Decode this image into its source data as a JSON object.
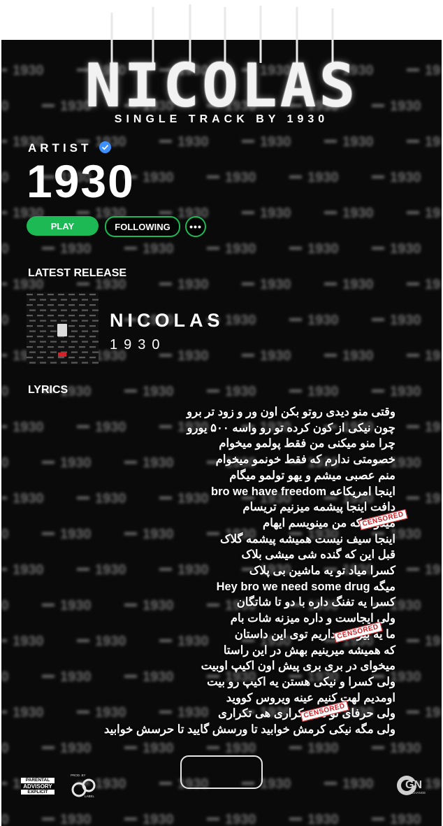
{
  "header": {
    "title": "NICOLAS",
    "subtitle": "SINGLE TRACK BY 1930"
  },
  "artist": {
    "label": "ARTIST",
    "name": "1930",
    "verified_icon": "verified-check-icon"
  },
  "actions": {
    "play_label": "PLAY",
    "following_label": "FOLLOWING",
    "more_label": "•••"
  },
  "latest_release": {
    "section_label": "LATEST RELEASE",
    "title": "NICOLAS",
    "artist": "1930"
  },
  "lyrics": {
    "section_label": "LYRICS",
    "lines": [
      "وقتی منو دیدی روتو بکن اون ور و زود تر برو",
      "چون نیکی از کون کرده تو رو واسه ۵۰۰ یورو",
      "چرا منو میکنی من فقط پولمو میخوام",
      "خصومتی ندارم که فقط خونمو میخوام",
      "منم عصبی میشم و یهو تولمو میگام",
      "اینجا امریکاعه bro we have freedom",
      "دافت اینجا پیشمه میزنیم تریسام",
      "میدونه که من مینویسم ایهام",
      "اینجا سیف نیست همیشه پیشمه گلاک",
      "قبل این که گنده شی میشی بلاک",
      "کسرا میاد تو یه ماشین بی پلاک",
      "میگه Hey bro we need some drug",
      "کسرا یه تفنگ داره با دو تا شاتگان",
      "ولی ایجاست و داره میزنه شات بام",
      "ما یه بیزنس داریم توی این داستان",
      "که همیشه میرینیم بهش در این راستا",
      "میخوای در بری بری پیش اون اکیپ اوبیت",
      "ولی کسرا و نیکی هستن یه اکیپ رو بیت",
      "اومدیم لهت کنیم عینه ویروس کووید",
      "ولی حرفای تو هی تکراری هی تکراری",
      "ولی مگه نیکی کرمش خوابید تا ورسش گایید تا حرسش خوابید"
    ],
    "censored_stamp": "CENSORED"
  },
  "footer": {
    "advisory_top": "PARENTAL",
    "advisory_mid": "ADVISORY",
    "advisory_bottom": "EXPLICIT CONTENT",
    "prod_label": "PROD. BY",
    "prod_sub": "LABEL",
    "gn_logo": "GN",
    "gn_sub": "EXCHANGE"
  },
  "background_text": "1930",
  "colors": {
    "accent": "#1db954",
    "verified": "#3d91ff",
    "censored": "#d2232a",
    "background": "#0a0a0a"
  }
}
